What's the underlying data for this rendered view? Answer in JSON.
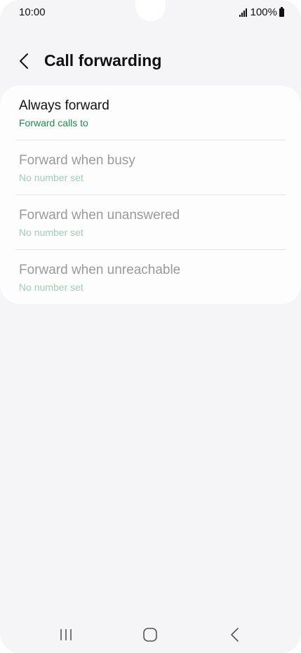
{
  "status_bar": {
    "time": "10:00",
    "battery": "100%"
  },
  "header": {
    "title": "Call forwarding"
  },
  "items": [
    {
      "title": "Always forward",
      "subtitle": "Forward calls to",
      "enabled": true
    },
    {
      "title": "Forward when busy",
      "subtitle": "No number set",
      "enabled": false
    },
    {
      "title": "Forward when unanswered",
      "subtitle": "No number set",
      "enabled": false
    },
    {
      "title": "Forward when unreachable",
      "subtitle": "No number set",
      "enabled": false
    }
  ],
  "colors": {
    "background": "#f5f5f7",
    "card": "#fdfdfe",
    "accent_green": "#1e8a4f",
    "disabled_text": "#9a9a9a",
    "disabled_sub": "#9ccfb3"
  },
  "nav": {
    "recents_icon": "recents-icon",
    "home_icon": "home-icon",
    "back_icon": "back-icon"
  }
}
